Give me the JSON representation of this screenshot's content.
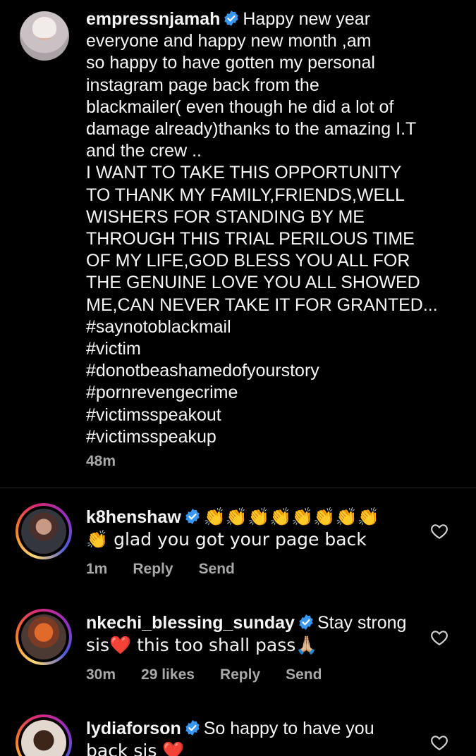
{
  "caption": {
    "username": "empressnjamah",
    "lines": [
      "Happy new year",
      "everyone and happy new month ,am",
      "so happy to have gotten my personal",
      "instagram page back from the",
      "blackmailer( even though he did a lot of",
      "damage already)thanks to the amazing I.T",
      "and the crew ..",
      "I WANT TO TAKE THIS OPPORTUNITY",
      "TO THANK MY FAMILY,FRIENDS,WELL",
      "WISHERS FOR STANDING BY ME",
      "THROUGH THIS TRIAL PERILOUS TIME",
      "OF MY LIFE,GOD BLESS YOU ALL FOR",
      "THE GENUINE LOVE YOU ALL SHOWED",
      "ME,CAN NEVER TAKE IT FOR GRANTED...",
      "#saynotoblackmail",
      "#victim",
      "#donotbeashamedofyourstory",
      "#pornrevengecrime",
      "#victimsspeakout",
      "#victimsspeakup"
    ],
    "time": "48m"
  },
  "comments": [
    {
      "username": "k8henshaw",
      "text_line1": "👏👏👏👏👏👏👏👏",
      "text_line2": "👏 glad you got your page back",
      "time": "1m",
      "likes": "",
      "reply": "Reply",
      "send": "Send"
    },
    {
      "username": "nkechi_blessing_sunday",
      "text_line1": "Stay strong",
      "text_line2": "sis❤️ this too shall pass🙏🏼",
      "time": "30m",
      "likes": "29 likes",
      "reply": "Reply",
      "send": "Send"
    },
    {
      "username": "lydiaforson",
      "text_line1": "So happy to have you",
      "text_line2": "back sis ❤️",
      "time": "",
      "likes": "",
      "reply": "",
      "send": ""
    }
  ],
  "colors": {
    "background": "#000000",
    "text": "#f5f5f5",
    "muted": "#a8a8a8",
    "verified": "#3897f0"
  }
}
